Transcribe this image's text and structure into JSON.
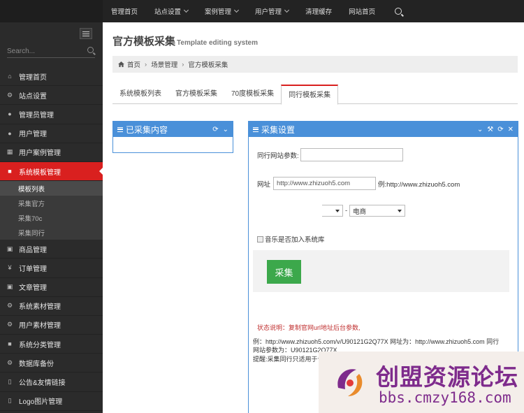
{
  "search": {
    "placeholder": "Search..."
  },
  "nav": {
    "items": [
      {
        "label": "管理首页",
        "icon": "home-icon"
      },
      {
        "label": "站点设置",
        "icon": "gears-icon"
      },
      {
        "label": "管理员管理",
        "icon": "user-icon"
      },
      {
        "label": "用户管理",
        "icon": "user-icon"
      },
      {
        "label": "用户案例管理",
        "icon": "table-icon"
      },
      {
        "label": "系统模板管理",
        "icon": "briefcase-icon"
      },
      {
        "label": "商品管理",
        "icon": "square-icon"
      },
      {
        "label": "订单管理",
        "icon": "yen-icon"
      },
      {
        "label": "文章管理",
        "icon": "square-icon"
      },
      {
        "label": "系统素材管理",
        "icon": "gears-icon"
      },
      {
        "label": "用户素材管理",
        "icon": "gears-icon"
      },
      {
        "label": "系统分类管理",
        "icon": "briefcase-icon"
      },
      {
        "label": "数据库备份",
        "icon": "gears-icon"
      },
      {
        "label": "公告&友情链接",
        "icon": "bookmark-icon"
      },
      {
        "label": "Logo图片管理",
        "icon": "bookmark-icon"
      }
    ],
    "sub_items": [
      "模板列表",
      "采集官方",
      "采集70c",
      "采集同行"
    ]
  },
  "topbar": {
    "links": [
      "管理首页",
      "站点设置",
      "案例管理",
      "用户管理",
      "清理缓存",
      "网站首页"
    ]
  },
  "page": {
    "title": "官方模板采集",
    "subtitle": "Template editing system"
  },
  "breadcrumb": [
    "首页",
    "场景管理",
    "官方模板采集"
  ],
  "tabs": [
    "系统模板列表",
    "官方模板采集",
    "70度模板采集",
    "同行模板采集"
  ],
  "left_panel": {
    "title": "已采集内容"
  },
  "right_panel": {
    "title": "采集设置",
    "param_label": "同行网站参数:",
    "param_value": "",
    "url_label": "网址",
    "url_value": "http://www.zhizuoh5.com",
    "url_example": "例:http://www.zhizuoh5.com",
    "category_selected": "电商",
    "dash": "-",
    "music_label": "音乐是否加入系统库",
    "collect_button": "采集",
    "status_note": "状态说明：复制官网url地址后台参数,",
    "example_line1": "例：http://www.zhizuoh5.com/v/U90121G2Q77X 网址为：http://www.zhizuoh5.com 同行",
    "example_line2": "网站参数为：U90121G2Q77X",
    "example_line3": "提醒:采集同行只适用于卡"
  },
  "watermark": {
    "cn": "创盟资源论坛",
    "url": "bbs.cmzy168.com"
  },
  "colors": {
    "accent": "#d9201f",
    "panel": "#4a90d9",
    "button": "#3ca84b"
  }
}
